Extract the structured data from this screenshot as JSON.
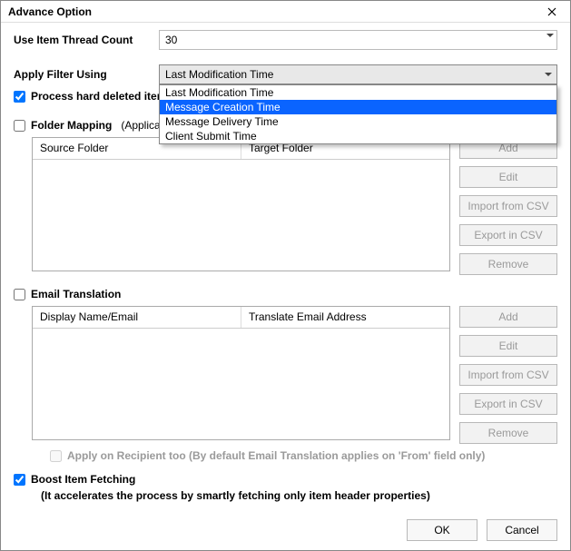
{
  "title": "Advance Option",
  "threadCount": {
    "label": "Use Item Thread Count",
    "value": "30"
  },
  "filter": {
    "label": "Apply Filter Using",
    "selected": "Last Modification Time",
    "options": [
      "Last Modification Time",
      "Message Creation Time",
      "Message Delivery Time",
      "Client Submit Time"
    ],
    "highlightedIndex": 1
  },
  "processHardDeleted": {
    "label": "Process hard deleted items",
    "checked": true
  },
  "folderMapping": {
    "label": "Folder Mapping",
    "checked": false,
    "hint": "(Applicable only on Root Folders)",
    "columns": [
      "Source Folder",
      "Target Folder"
    ],
    "buttons": [
      "Add",
      "Edit",
      "Import from CSV",
      "Export in CSV",
      "Remove"
    ]
  },
  "emailTranslation": {
    "label": "Email Translation",
    "checked": false,
    "columns": [
      "Display Name/Email",
      "Translate Email Address"
    ],
    "buttons": [
      "Add",
      "Edit",
      "Import from CSV",
      "Export in CSV",
      "Remove"
    ],
    "applyRecipient": {
      "label": "Apply on Recipient too (By default Email Translation applies on 'From' field only)",
      "checked": false
    }
  },
  "boost": {
    "label": "Boost Item Fetching",
    "checked": true,
    "note": "(It accelerates the process by smartly fetching only item header properties)"
  },
  "footer": {
    "ok": "OK",
    "cancel": "Cancel"
  }
}
